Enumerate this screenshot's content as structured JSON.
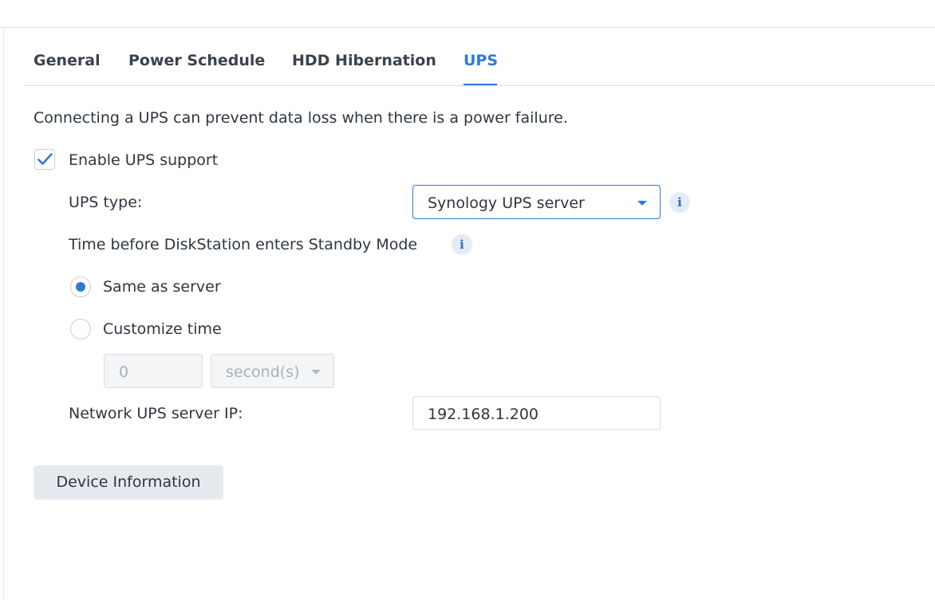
{
  "tabs": [
    {
      "label": "General"
    },
    {
      "label": "Power Schedule"
    },
    {
      "label": "HDD Hibernation"
    },
    {
      "label": "UPS",
      "active": true
    }
  ],
  "description": "Connecting a UPS can prevent data loss when there is a power failure.",
  "enable_ups": {
    "label": "Enable UPS support",
    "checked": true
  },
  "ups_type": {
    "label": "UPS type:",
    "value": "Synology UPS server",
    "info_icon": "i"
  },
  "standby": {
    "label": "Time before DiskStation enters Standby Mode",
    "info_icon": "i"
  },
  "radio_same": {
    "label": "Same as server",
    "selected": true
  },
  "radio_custom": {
    "label": "Customize time",
    "selected": false
  },
  "custom_time": {
    "value": "0",
    "unit": "second(s)"
  },
  "server_ip": {
    "label": "Network UPS server IP:",
    "value": "192.168.1.200"
  },
  "device_info_button": "Device Information",
  "colors": {
    "accent": "#2e7ad6",
    "text": "#2f3640",
    "disabled_bg": "#f4f5f7"
  }
}
